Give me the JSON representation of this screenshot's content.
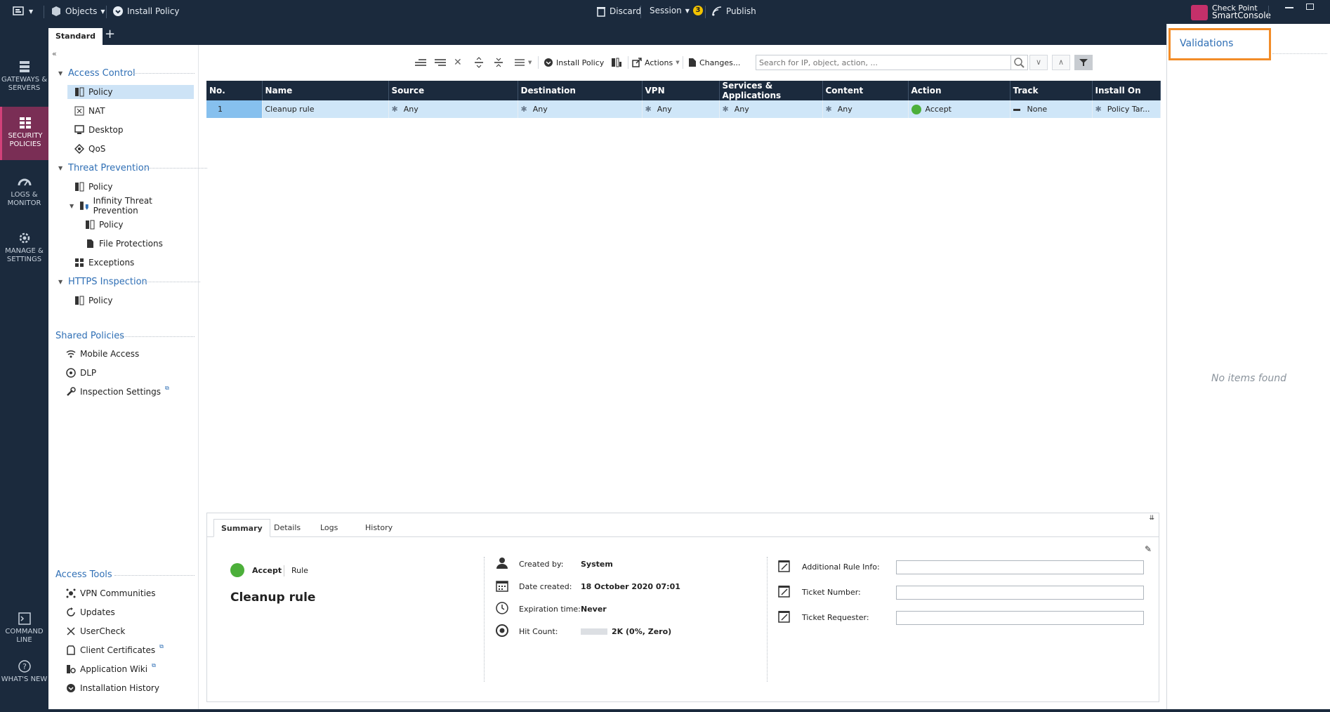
{
  "topbar": {
    "objects_label": "Objects",
    "install_policy_label": "Install Policy",
    "discard_label": "Discard",
    "session_label": "Session",
    "session_badge": "3",
    "publish_label": "Publish",
    "logo_line1": "Check Point",
    "logo_line2": "SmartConsole"
  },
  "leftnav": {
    "gateways": "GATEWAYS & SERVERS",
    "security": "SECURITY POLICIES",
    "logs": "LOGS & MONITOR",
    "manage": "MANAGE & SETTINGS",
    "command": "COMMAND LINE",
    "whatsnew": "WHAT'S NEW"
  },
  "tabs": {
    "active": "Standard",
    "add": "+"
  },
  "tree": {
    "collapse": "«",
    "access_control": "Access Control",
    "ac_policy": "Policy",
    "nat": "NAT",
    "desktop": "Desktop",
    "qos": "QoS",
    "threat_prevention": "Threat Prevention",
    "tp_policy": "Policy",
    "infinity": "Infinity Threat Prevention",
    "inf_policy": "Policy",
    "file_protections": "File Protections",
    "exceptions": "Exceptions",
    "https_inspection": "HTTPS Inspection",
    "https_policy": "Policy",
    "shared_policies": "Shared Policies",
    "mobile_access": "Mobile Access",
    "dlp": "DLP",
    "inspection_settings": "Inspection Settings",
    "access_tools": "Access Tools",
    "vpn_communities": "VPN Communities",
    "updates": "Updates",
    "usercheck": "UserCheck",
    "client_certificates": "Client Certificates",
    "application_wiki": "Application Wiki",
    "installation_history": "Installation History"
  },
  "toolbar": {
    "install_policy": "Install Policy",
    "actions": "Actions",
    "changes": "Changes...",
    "search_placeholder": "Search for IP, object, action, ..."
  },
  "rules": {
    "headers": [
      "No.",
      "Name",
      "Source",
      "Destination",
      "VPN",
      "Services & Applications",
      "Content",
      "Action",
      "Track",
      "Install On"
    ],
    "row": {
      "no": "1",
      "name": "Cleanup rule",
      "source": "Any",
      "destination": "Any",
      "vpn": "Any",
      "services": "Any",
      "content": "Any",
      "action": "Accept",
      "track": "None",
      "install_on": "Policy Tar..."
    }
  },
  "detail": {
    "tabs": [
      "Summary",
      "Details",
      "Logs",
      "History"
    ],
    "action": "Accept",
    "type": "Rule",
    "rule_name": "Cleanup rule",
    "created_by_label": "Created by:",
    "created_by": "System",
    "date_created_label": "Date created:",
    "date_created": "18 October 2020 07:01",
    "expiration_label": "Expiration time:",
    "expiration": "Never",
    "hit_count_label": "Hit Count:",
    "hit_count": "2K (0%, Zero)",
    "additional_info_label": "Additional Rule Info:",
    "ticket_number_label": "Ticket Number:",
    "ticket_requester_label": "Ticket Requester:"
  },
  "validations": {
    "title": "Validations",
    "empty": "No items found"
  }
}
